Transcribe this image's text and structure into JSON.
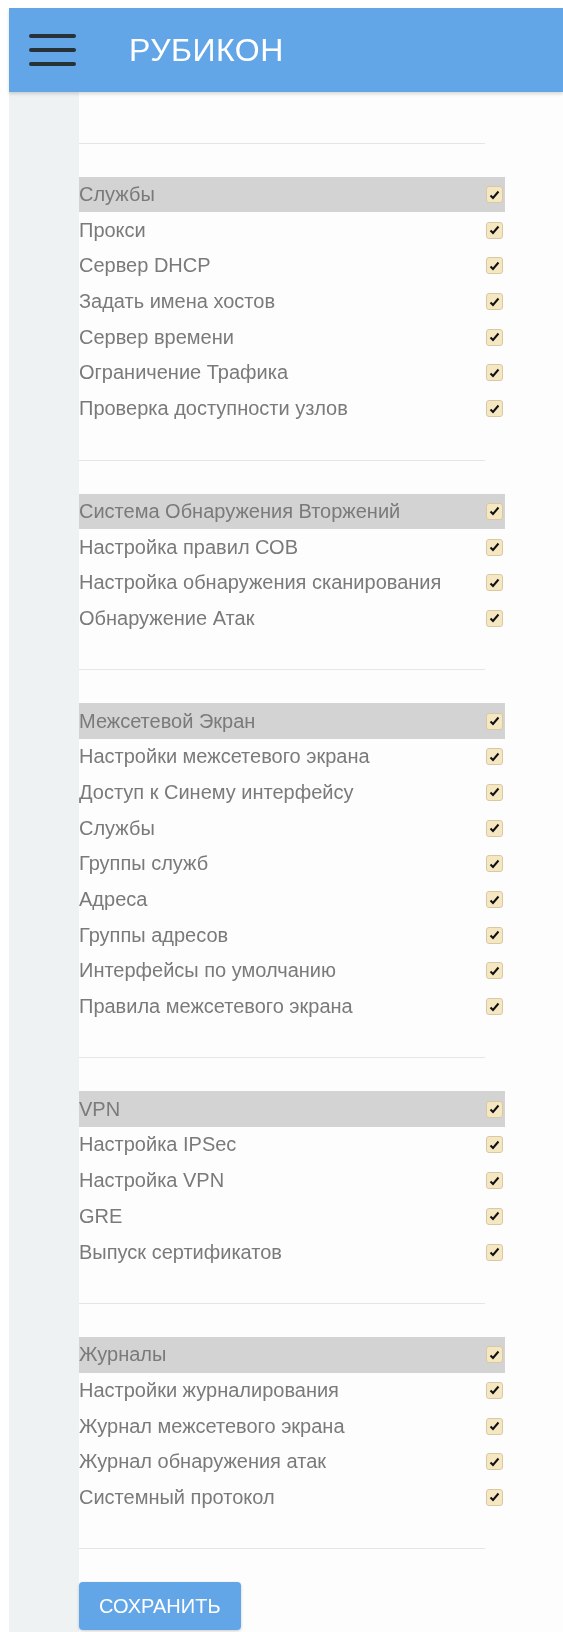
{
  "header": {
    "title": "РУБИКОН"
  },
  "sections": [
    {
      "title": "Службы",
      "checked": true,
      "items": [
        {
          "label": "Прокси",
          "checked": true
        },
        {
          "label": "Сервер DHCP",
          "checked": true
        },
        {
          "label": "Задать имена хостов",
          "checked": true
        },
        {
          "label": "Сервер времени",
          "checked": true
        },
        {
          "label": "Ограничение Трафика",
          "checked": true
        },
        {
          "label": "Проверка доступности узлов",
          "checked": true
        }
      ]
    },
    {
      "title": "Система Обнаружения Вторжений",
      "checked": true,
      "items": [
        {
          "label": "Настройка правил СОВ",
          "checked": true
        },
        {
          "label": "Настройка обнаружения сканирования",
          "checked": true
        },
        {
          "label": "Обнаружение Атак",
          "checked": true
        }
      ]
    },
    {
      "title": "Межсетевой Экран",
      "checked": true,
      "items": [
        {
          "label": "Настройки межсетевого экрана",
          "checked": true
        },
        {
          "label": "Доступ к Синему интерфейсу",
          "checked": true
        },
        {
          "label": "Службы",
          "checked": true
        },
        {
          "label": "Группы служб",
          "checked": true
        },
        {
          "label": "Адреса",
          "checked": true
        },
        {
          "label": "Группы адресов",
          "checked": true
        },
        {
          "label": "Интерфейсы по умолчанию",
          "checked": true
        },
        {
          "label": "Правила межсетевого экрана",
          "checked": true
        }
      ]
    },
    {
      "title": "VPN",
      "checked": true,
      "items": [
        {
          "label": "Настройка IPSec",
          "checked": true
        },
        {
          "label": "Настройка VPN",
          "checked": true
        },
        {
          "label": "GRE",
          "checked": true
        },
        {
          "label": "Выпуск сертификатов",
          "checked": true
        }
      ]
    },
    {
      "title": "Журналы",
      "checked": true,
      "items": [
        {
          "label": "Настройки журналирования",
          "checked": true
        },
        {
          "label": "Журнал межсетевого экрана",
          "checked": true
        },
        {
          "label": "Журнал обнаружения атак",
          "checked": true
        },
        {
          "label": "Системный протокол",
          "checked": true
        }
      ]
    }
  ],
  "save_button": "СОХРАНИТЬ"
}
